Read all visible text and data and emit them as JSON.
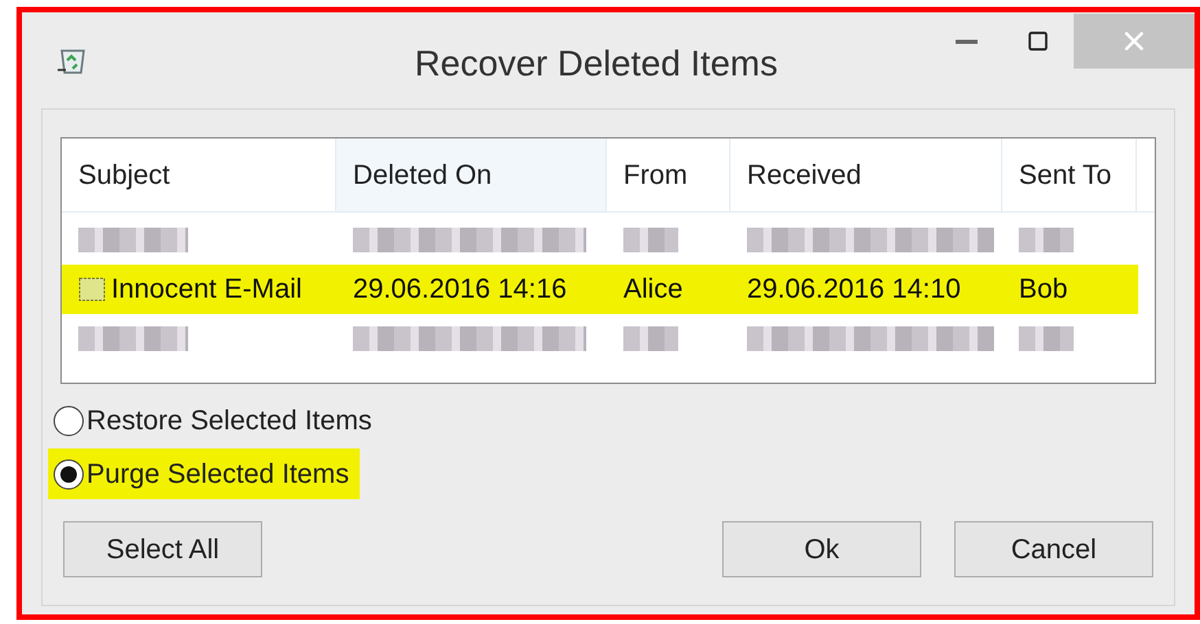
{
  "window": {
    "title": "Recover Deleted Items"
  },
  "table": {
    "columns": [
      "Subject",
      "Deleted On",
      "From",
      "Received",
      "Sent To"
    ],
    "rows": [
      {
        "kind": "blurred",
        "highlighted": false
      },
      {
        "kind": "item",
        "highlighted": true,
        "cells": [
          "Innocent E-Mail",
          "29.06.2016 14:16",
          "Alice",
          "29.06.2016 14:10",
          "Bob"
        ]
      },
      {
        "kind": "blurred",
        "highlighted": false
      }
    ]
  },
  "options": [
    {
      "label": "Restore Selected Items",
      "selected": false,
      "highlighted": false
    },
    {
      "label": "Purge Selected Items",
      "selected": true,
      "highlighted": true
    }
  ],
  "buttons": {
    "left": [
      "Select All"
    ],
    "right": [
      "Ok",
      "Cancel"
    ]
  }
}
